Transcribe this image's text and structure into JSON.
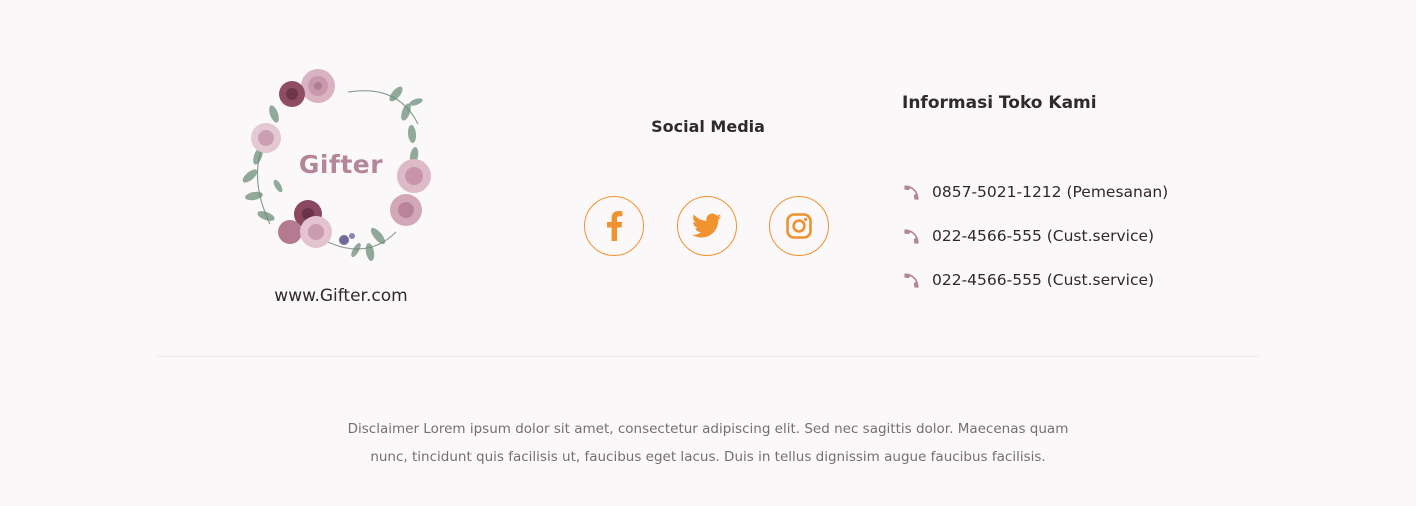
{
  "brand": {
    "logo_text": "Gifter",
    "website": "www.Gifter.com"
  },
  "social": {
    "title": "Social Media",
    "items": [
      {
        "name": "Facebook",
        "icon": "facebook-icon"
      },
      {
        "name": "Twitter",
        "icon": "twitter-icon"
      },
      {
        "name": "Instagram",
        "icon": "instagram-icon"
      }
    ],
    "accent_color": "#f0922f"
  },
  "info": {
    "title": "Informasi Toko Kami",
    "icon": "phone-icon",
    "icon_color": "#b4869a",
    "items": [
      "0857-5021-1212 (Pemesanan)",
      "022-4566-555 (Cust.service)",
      "022-4566-555 (Cust.service)"
    ]
  },
  "disclaimer": {
    "line1": "Disclaimer Lorem ipsum dolor sit amet, consectetur adipiscing elit. Sed nec sagittis dolor. Maecenas quam",
    "line2": "nunc, tincidunt quis facilisis ut, faucibus eget lacus. Duis in tellus dignissim augue faucibus facilisis."
  }
}
